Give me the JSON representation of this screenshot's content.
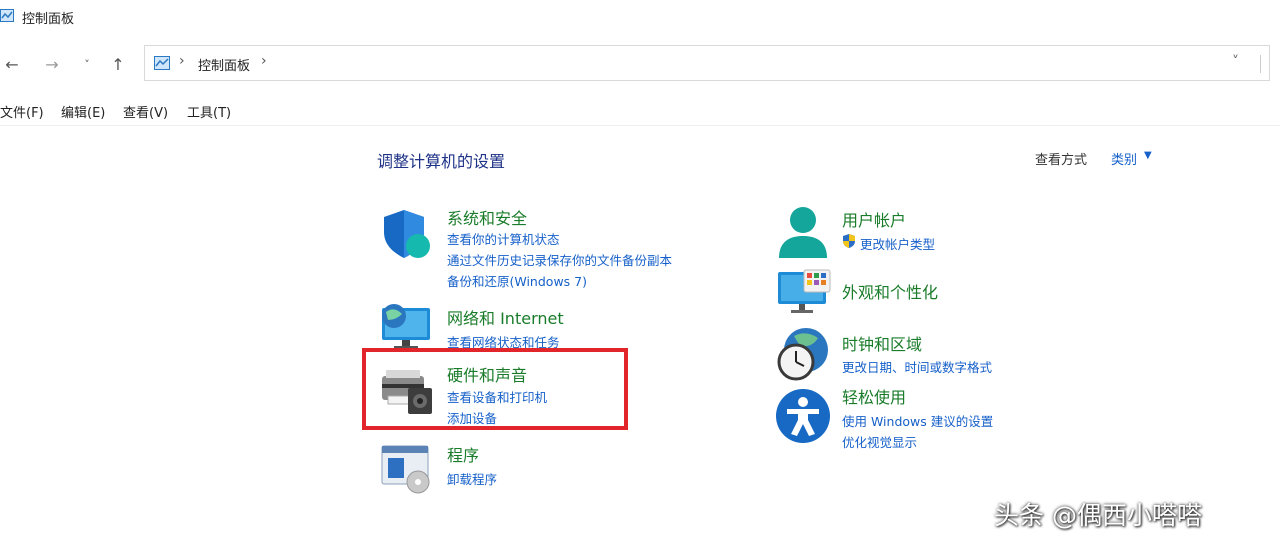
{
  "window": {
    "title": "控制面板"
  },
  "nav": {
    "back_icon": "back-arrow-icon",
    "forward_icon": "forward-arrow-icon",
    "recent_icon": "chevron-down-icon",
    "up_icon": "up-arrow-icon",
    "address": {
      "crumb": "控制面板",
      "separator": "›"
    }
  },
  "menu": [
    "文件(F)",
    "编辑(E)",
    "查看(V)",
    "工具(T)"
  ],
  "main": {
    "heading": "调整计算机的设置",
    "view_by_label": "查看方式",
    "view_by_value": "类别",
    "left_categories": [
      {
        "title": "系统和安全",
        "icon": "shield-icon",
        "links": [
          "查看你的计算机状态",
          "通过文件历史记录保存你的文件备份副本",
          "备份和还原(Windows 7)"
        ]
      },
      {
        "title": "网络和 Internet",
        "icon": "network-globe-icon",
        "links": [
          "查看网络状态和任务"
        ]
      },
      {
        "title": "硬件和声音",
        "icon": "printer-speaker-icon",
        "links": [
          "查看设备和打印机",
          "添加设备"
        ]
      },
      {
        "title": "程序",
        "icon": "programs-disc-icon",
        "links": [
          "卸载程序"
        ]
      }
    ],
    "right_categories": [
      {
        "title": "用户帐户",
        "icon": "user-icon",
        "links": [
          "更改帐户类型"
        ]
      },
      {
        "title": "外观和个性化",
        "icon": "monitor-personalize-icon",
        "links": []
      },
      {
        "title": "时钟和区域",
        "icon": "clock-globe-icon",
        "links": [
          "更改日期、时间或数字格式"
        ]
      },
      {
        "title": "轻松使用",
        "icon": "accessibility-icon",
        "links": [
          "使用 Windows 建议的设置",
          "优化视觉显示"
        ]
      }
    ]
  },
  "colors": {
    "heading": "#1e3287",
    "category_title": "#1a7c2a",
    "link": "#1660c9",
    "highlight": "#e1252b"
  },
  "watermark": "头条 @偶西小嗒嗒"
}
